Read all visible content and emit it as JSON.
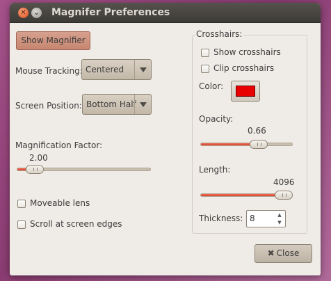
{
  "window": {
    "title": "Magnifer Preferences",
    "close_glyph": "✕",
    "menu_glyph": "⌄"
  },
  "left": {
    "show_magnifier_label": "Show Magnifier",
    "mouse_tracking_label": "Mouse Tracking:",
    "mouse_tracking_value": "Centered",
    "screen_position_label": "Screen Position:",
    "screen_position_value": "Bottom Half",
    "magnification_label": "Magnification Factor:",
    "magnification_value": "2.00",
    "magnification_fraction": 0.08,
    "moveable_lens_label": "Moveable lens",
    "scroll_edges_label": "Scroll at screen edges"
  },
  "crosshairs": {
    "frame_title": "Crosshairs:",
    "show_label": "Show crosshairs",
    "clip_label": "Clip crosshairs",
    "color_label": "Color:",
    "color_value": "#e80000",
    "opacity_label": "Opacity:",
    "opacity_value": "0.66",
    "opacity_fraction": 0.66,
    "length_label": "Length:",
    "length_value": "4096",
    "length_fraction": 1.0,
    "thickness_label": "Thickness:",
    "thickness_value": "8"
  },
  "footer": {
    "close_label": "Close",
    "close_icon_glyph": "✖"
  },
  "colors": {
    "accent": "#e8503a",
    "window_bg": "#efebe7",
    "titlebar": "#3d3b37"
  }
}
